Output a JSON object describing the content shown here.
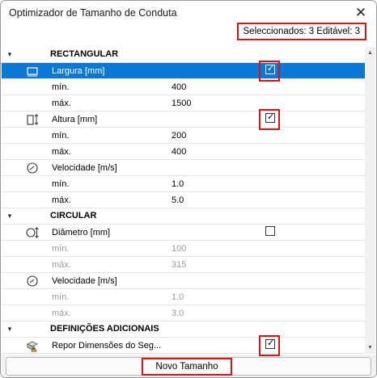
{
  "window": {
    "title": "Optimizador de Tamanho de Conduta"
  },
  "status": {
    "selection_text": "Seleccionados: 3 Editável: 3"
  },
  "sections": {
    "rect": {
      "label": "RECTANGULAR"
    },
    "circ": {
      "label": "CIRCULAR"
    },
    "extra": {
      "label": "DEFINIÇÕES ADICIONAIS"
    }
  },
  "params": {
    "largura": {
      "label": "Largura [mm]",
      "checked": true,
      "min_label": "mín.",
      "min": "400",
      "max_label": "máx.",
      "max": "1500"
    },
    "altura": {
      "label": "Altura [mm]",
      "checked": true,
      "min_label": "mín.",
      "min": "200",
      "max_label": "máx.",
      "max": "400"
    },
    "velocidade_rect": {
      "label": "Velocidade [m/s]",
      "min_label": "mín.",
      "min": "1.0",
      "max_label": "máx.",
      "max": "5.0"
    },
    "diametro": {
      "label": "Diâmetro [mm]",
      "checked": false,
      "min_label": "mín.",
      "min": "100",
      "max_label": "máx.",
      "max": "315"
    },
    "velocidade_circ": {
      "label": "Velocidade [m/s]",
      "min_label": "mín.",
      "min": "1.0",
      "max_label": "máx.",
      "max": "3.0"
    },
    "repor": {
      "label": "Repor Dimensões do Seg...",
      "checked": true
    }
  },
  "footer": {
    "new_size_button": "Novo Tamanho"
  },
  "colors": {
    "selection": "#0a78d4",
    "highlight": "#e01010"
  },
  "icons": {
    "close": "close-icon",
    "width": "width-icon",
    "height": "height-icon",
    "velocity": "velocity-icon",
    "diameter": "diameter-icon",
    "warning": "warning-icon"
  }
}
